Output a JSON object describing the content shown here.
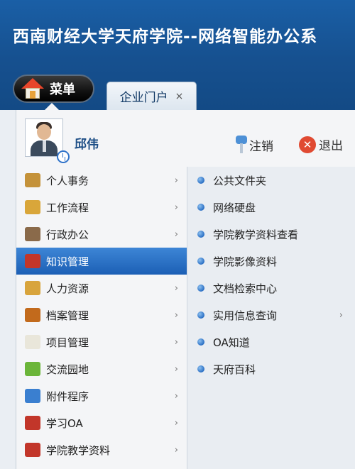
{
  "header": {
    "app_title": "西南财经大学天府学院--网络智能办公系",
    "menu_button": "菜单",
    "tab": {
      "label": "企业门户",
      "close": "×"
    }
  },
  "user": {
    "name": "邱伟",
    "logout": "注销",
    "exit": "退出",
    "exit_symbol": "✕"
  },
  "left_menu": {
    "arrow": "›",
    "items": [
      {
        "label": "个人事务",
        "icon": "people-icon",
        "color": "#c4923a"
      },
      {
        "label": "工作流程",
        "icon": "workflow-icon",
        "color": "#d9a63a"
      },
      {
        "label": "行政办公",
        "icon": "group-icon",
        "color": "#8a6a4a"
      },
      {
        "label": "知识管理",
        "icon": "book-icon",
        "color": "#c2362a",
        "active": true
      },
      {
        "label": "人力资源",
        "icon": "folder-person-icon",
        "color": "#d8a43c"
      },
      {
        "label": "档案管理",
        "icon": "briefcase-icon",
        "color": "#c26a1c"
      },
      {
        "label": "项目管理",
        "icon": "chart-doc-icon",
        "color": "#e9e6da"
      },
      {
        "label": "交流园地",
        "icon": "chat-icon",
        "color": "#6bb53a"
      },
      {
        "label": "附件程序",
        "icon": "gear-icon",
        "color": "#3a7fd0"
      },
      {
        "label": "学习OA",
        "icon": "book-icon",
        "color": "#c2362a"
      },
      {
        "label": "学院教学资料",
        "icon": "book-icon",
        "color": "#c2362a"
      }
    ]
  },
  "sub_menu": {
    "arrow": "›",
    "items": [
      {
        "label": "公共文件夹"
      },
      {
        "label": "网络硬盘"
      },
      {
        "label": "学院教学资料查看"
      },
      {
        "label": "学院影像资料"
      },
      {
        "label": "文档检索中心"
      },
      {
        "label": "实用信息查询",
        "has_children": true
      },
      {
        "label": "OA知道"
      },
      {
        "label": "天府百科"
      }
    ]
  },
  "colors": {
    "header_blue": "#16508f",
    "active_blue": "#1c5fb5",
    "username_blue": "#1d4e86"
  }
}
